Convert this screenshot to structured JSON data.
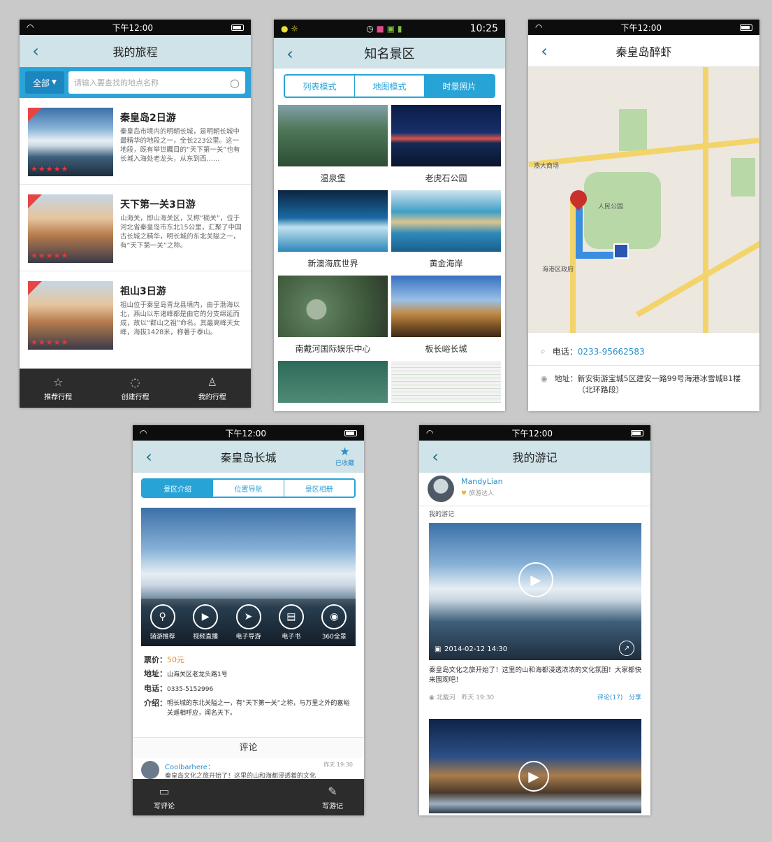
{
  "status": {
    "time": "下午12:00",
    "time_android": "10:25"
  },
  "phone1": {
    "title": "我的旅程",
    "filter_label": "全部",
    "search_placeholder": "请输入要查找的地点名称",
    "trips": [
      {
        "title": "秦皇岛2日游",
        "desc": "秦皇岛市境内的明朝长城，是明朝长城中最精华的地段之一，全长223公里。这一地段，既有举世瞩目的“天下第一关”也有长城入海处老龙头，从东到西……",
        "stars": "★★★★★"
      },
      {
        "title": "天下第一关3日游",
        "desc": "山海关，即山海关区，又称“榆关”，位于河北省秦皇岛市东北15公里，汇聚了中国古长城之精华，明长城的东北关隘之一，有“天下第一关”之称。",
        "stars": "★★★★★"
      },
      {
        "title": "祖山3日游",
        "desc": "祖山位于秦皇岛青龙县境内，由于渤海以北，燕山以东诸峰都是由它的分支绵延而成，故以“群山之祖”命名。其最高峰天女峰，海拔1428米，称著于泰山。",
        "stars": "★★★★★"
      }
    ],
    "tabs": [
      {
        "label": "推荐行程",
        "icon": "☆"
      },
      {
        "label": "创建行程",
        "icon": "◌"
      },
      {
        "label": "我的行程",
        "icon": "♙"
      }
    ]
  },
  "phone2": {
    "title": "知名景区",
    "modes": [
      "列表模式",
      "地图模式",
      "时景照片"
    ],
    "spots": [
      "温泉堡",
      "老虎石公园",
      "新澳海底世界",
      "黄金海岸",
      "南戴河国际娱乐中心",
      "板长峪长城"
    ]
  },
  "phone3": {
    "title": "秦皇岛醉虾",
    "map_labels": [
      "人民公园",
      "燕大商场",
      "海港区政府"
    ],
    "phone_label": "电话：",
    "phone_value": "0233-95662583",
    "address_label": "地址：",
    "address_value": "新安街游宝城5区建安一路99号海港冰雪城B1楼（北环路段）"
  },
  "phone4": {
    "title": "秦皇岛长城",
    "fav_label": "已收藏",
    "tabs": [
      "景区介绍",
      "位置导航",
      "景区相册"
    ],
    "actions": [
      "骑游推荐",
      "视频直播",
      "电子导游",
      "电子书",
      "360全景"
    ],
    "ticket_label": "票价：",
    "ticket_value": "50元",
    "addr_label": "地址：",
    "addr_value": "山海关区老龙头路1号",
    "tel_label": "电话：",
    "tel_value": "0335-5152996",
    "intro_label": "介绍：",
    "intro_value": "明长城的东北关隘之一，有“天下第一关”之称，与万里之外的嘉峪关遥相呼应，闻名天下。",
    "comments_title": "评论",
    "commenter": "Coolbarhere：",
    "comment_time": "昨天 19:30",
    "comment_text": "秦皇岛文化之旅开始了！这里的山和海都浸透着的文化",
    "bottom": [
      {
        "label": "写评论",
        "icon": "▭"
      },
      {
        "label": "写游记",
        "icon": "✎"
      }
    ]
  },
  "phone5": {
    "title": "我的游记",
    "user": "MandyLian",
    "badge": "旅游达人",
    "section": "我的游记",
    "post_time": "2014-02-12  14:30",
    "post_text": "秦皇岛文化之旅开始了！这里的山和海都浸透浓浓的文化氛围！大家都快来围观吧！",
    "meta_left": "北戴河",
    "meta_mid": "昨天 19:30",
    "comment_link": "评论(17)",
    "share_link": "分享"
  }
}
